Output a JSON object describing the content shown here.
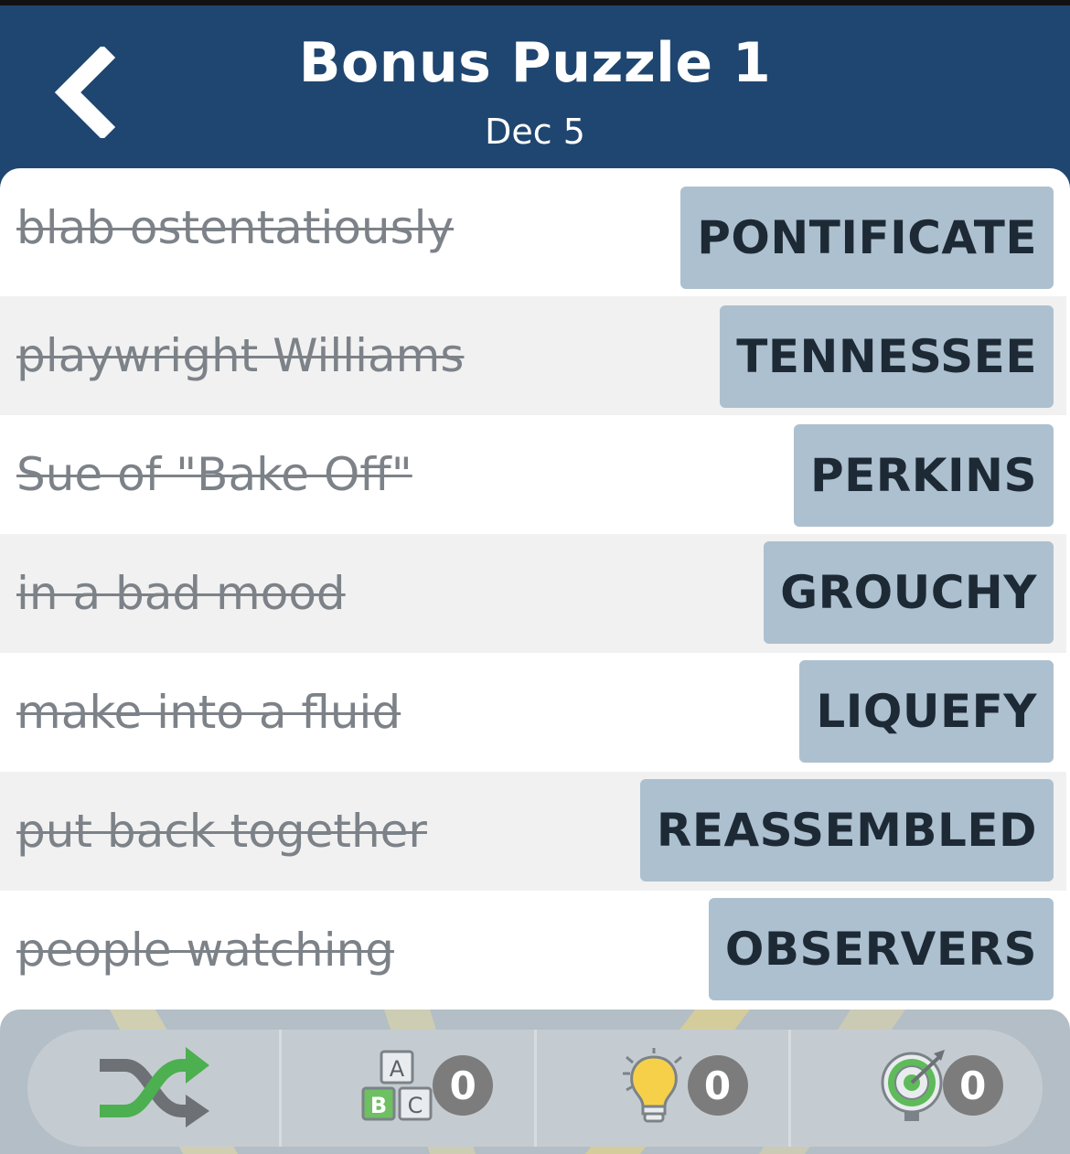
{
  "header": {
    "title": "Bonus Puzzle 1",
    "date": "Dec 5",
    "back_icon": "chevron-left-icon"
  },
  "clues": [
    {
      "clue": "blab ostentatiously",
      "answer": "PONTIFICATE"
    },
    {
      "clue": "playwright Williams",
      "answer": "TENNESSEE"
    },
    {
      "clue": "Sue of \"Bake Off\"",
      "answer": "PERKINS"
    },
    {
      "clue": "in a bad mood",
      "answer": "GROUCHY"
    },
    {
      "clue": "make into a fluid",
      "answer": "LIQUEFY"
    },
    {
      "clue": "put back together",
      "answer": "REASSEMBLED"
    },
    {
      "clue": "people watching",
      "answer": "OBSERVERS"
    }
  ],
  "toolbar": {
    "shuffle_icon": "shuffle-icon",
    "letters": {
      "icon": "letter-blocks-icon",
      "blocks": [
        "A",
        "B",
        "C"
      ],
      "count": "0"
    },
    "hint": {
      "icon": "lightbulb-icon",
      "count": "0"
    },
    "target": {
      "icon": "target-icon",
      "count": "0"
    }
  },
  "colors": {
    "header_bg": "#1f4670",
    "answer_bg": "#adc0cf",
    "answer_text": "#1d2a36",
    "clue_text": "#7c8288",
    "shuffle_green": "#4caf50",
    "shuffle_gray": "#6d7175",
    "badge_bg": "#7c7c7c"
  }
}
